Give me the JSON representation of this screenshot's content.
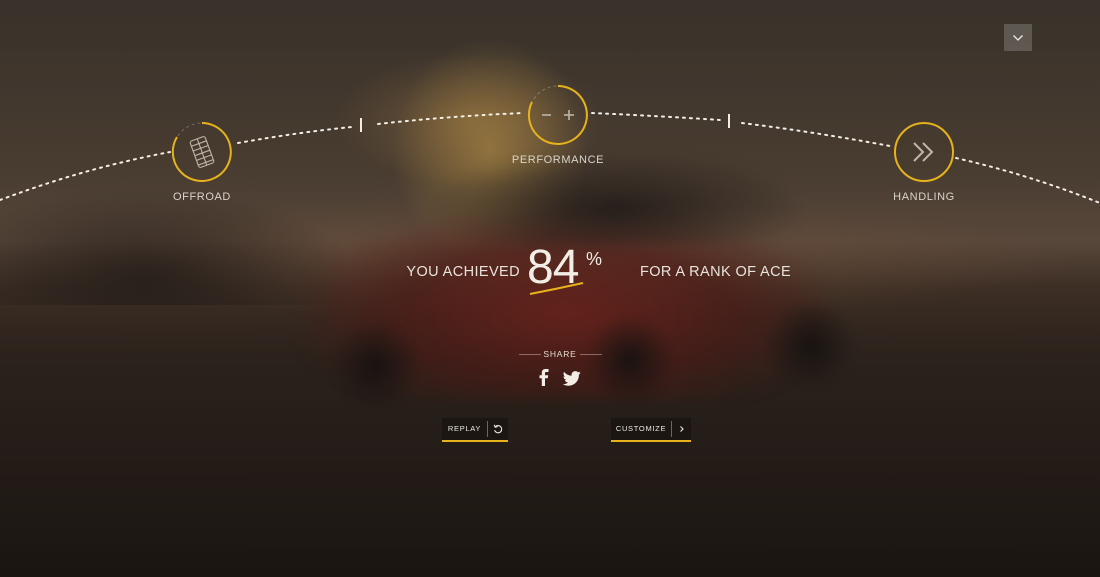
{
  "nav": {
    "menu_icon": "chevron-down-icon"
  },
  "categories": [
    {
      "label": "OFFROAD",
      "icon": "tire-tread-icon"
    },
    {
      "label": "PERFORMANCE",
      "icon": "minus-plus-icon"
    },
    {
      "label": "HANDLING",
      "icon": "double-chevron-right-icon"
    }
  ],
  "result": {
    "prefix": "YOU ACHIEVED",
    "score": "84",
    "percent_sign": "%",
    "suffix": "FOR A RANK OF ACE"
  },
  "share": {
    "label": "SHARE",
    "icons": [
      "facebook-icon",
      "twitter-icon"
    ]
  },
  "buttons": {
    "replay": {
      "label": "REPLAY",
      "icon": "replay-icon"
    },
    "customize": {
      "label": "CUSTOMIZE",
      "icon": "chevron-right-icon"
    }
  },
  "colors": {
    "accent": "#e7b21c",
    "text": "#e8e4dc"
  }
}
